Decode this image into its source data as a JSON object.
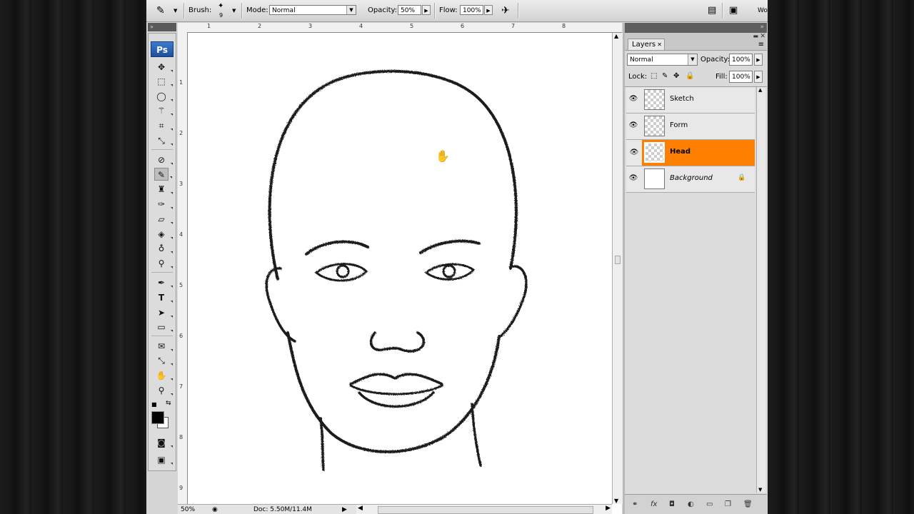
{
  "options_bar": {
    "brush_label": "Brush:",
    "brush_size": "9",
    "mode_label": "Mode:",
    "mode_value": "Normal",
    "opacity_label": "Opacity:",
    "opacity_value": "50%",
    "flow_label": "Flow:",
    "flow_value": "100%",
    "workspace_label": "Wo"
  },
  "toolbox": {
    "logo": "Ps",
    "tools": [
      "move-tool",
      "marquee-tool",
      "lasso-tool",
      "magic-wand-tool",
      "crop-tool",
      "eyedropper-tool",
      "healing-tool",
      "brush-tool",
      "clone-stamp-tool",
      "history-brush-tool",
      "eraser-tool",
      "paint-bucket-tool",
      "blur-tool",
      "dodge-tool",
      "pen-tool",
      "type-tool",
      "path-select-tool",
      "shape-tool",
      "notes-tool",
      "eyedropper-tool-2",
      "hand-tool",
      "zoom-tool"
    ],
    "active_tool": "brush-tool"
  },
  "ruler": {
    "top": [
      "1",
      "2",
      "3",
      "4",
      "5",
      "6",
      "7",
      "8"
    ],
    "left": [
      "1",
      "2",
      "3",
      "4",
      "5",
      "6",
      "7",
      "8",
      "9"
    ]
  },
  "status": {
    "zoom": "50%",
    "doc": "Doc: 5.50M/11.4M"
  },
  "layers_panel": {
    "tab_label": "Layers",
    "blend_mode": "Normal",
    "opacity_label": "Opacity:",
    "opacity_value": "100%",
    "lock_label": "Lock:",
    "fill_label": "Fill:",
    "fill_value": "100%",
    "layers": [
      {
        "name": "Sketch",
        "selected": false
      },
      {
        "name": "Form",
        "selected": false
      },
      {
        "name": "Head",
        "selected": true
      },
      {
        "name": "Background",
        "selected": false,
        "locked": true
      }
    ],
    "accent_color": "#ff8000"
  }
}
